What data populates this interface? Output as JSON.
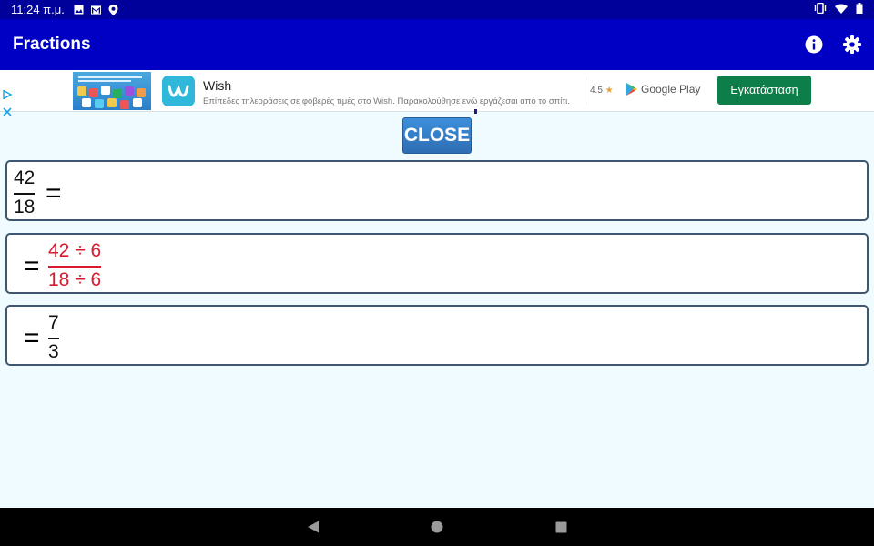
{
  "status_bar": {
    "time": "11:24 π.μ.",
    "left_icons": [
      "image-icon",
      "gmail-icon",
      "location-icon"
    ],
    "right_icons": [
      "vibrate-icon",
      "wifi-icon",
      "battery-icon"
    ]
  },
  "app_bar": {
    "title": "Fractions",
    "actions": [
      "info-icon",
      "settings-icon"
    ]
  },
  "ad": {
    "thumbnail_text": "MILLIONS OF UNIQUE, WONDERFUL ITEMS THAT'LL MAKE YOU SMILE",
    "app_name": "Wish",
    "description": "Επίπεδες τηλεοράσεις σε φοβερές τιμές στο Wish. Παρακολούθησε ενώ εργάζεσαι από το σπίτι.",
    "rating": "4.5",
    "store": "Google Play",
    "install_label": "Εγκατάσταση"
  },
  "close_button": {
    "label": "CLOSE"
  },
  "steps": [
    {
      "prefix": "",
      "numerator": "42",
      "denominator": "18",
      "suffix": "=",
      "color": "#111111"
    },
    {
      "prefix": "=",
      "numerator": "42 ÷ 6",
      "denominator": "18 ÷ 6",
      "suffix": "",
      "color": "#d8192e"
    },
    {
      "prefix": "=",
      "numerator": "7",
      "denominator": "3",
      "suffix": "",
      "color": "#111111"
    }
  ],
  "nav_bar": {
    "buttons": [
      "back-icon",
      "home-icon",
      "recents-icon"
    ]
  }
}
